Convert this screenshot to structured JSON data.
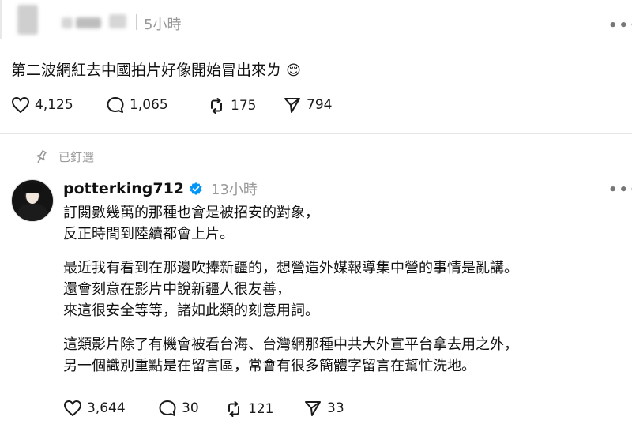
{
  "post": {
    "time": "5小時",
    "text": "第二波網紅去中國拍片好像開始冒出來ㄌ",
    "emoji": "😌",
    "stats": {
      "likes": "4,125",
      "comments": "1,065",
      "reposts": "175",
      "shares": "794"
    }
  },
  "reply": {
    "pinned_label": "已釘選",
    "username": "potterking712",
    "time": "13小時",
    "paragraphs": [
      [
        "訂閱數幾萬的那種也會是被招安的對象，",
        "反正時間到陸續都會上片。"
      ],
      [
        "最近我有看到在那邊吹捧新疆的，想營造外媒報導集中營的事情是亂講。",
        "還會刻意在影片中說新疆人很友善，",
        "來這很安全等等，諸如此類的刻意用詞。"
      ],
      [
        "這類影片除了有機會被看台海、台灣網那種中共大外宣平台拿去用之外，",
        "另一個識別重點是在留言區，常會有很多簡體字留言在幫忙洗地。"
      ]
    ],
    "stats": {
      "likes": "3,644",
      "comments": "30",
      "reposts": "121",
      "shares": "33"
    }
  },
  "icons": {
    "like": "heart-icon",
    "comment": "comment-icon",
    "repost": "repost-icon",
    "share": "share-icon",
    "pin": "pin-icon",
    "verified": "verified-badge-icon",
    "more": "more-options-icon"
  },
  "colors": {
    "verified": "#0095f6",
    "muted": "#999999",
    "divider": "#e6e6e6"
  }
}
